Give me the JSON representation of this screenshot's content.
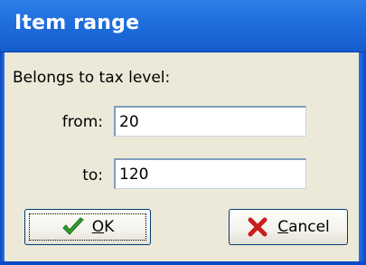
{
  "window": {
    "title": "Item range"
  },
  "form": {
    "heading": "Belongs to tax level:",
    "from_label": "from:",
    "from_value": "20",
    "to_label": "to:",
    "to_value": "120"
  },
  "buttons": {
    "ok": {
      "accel": "O",
      "rest": "K",
      "icon": "checkmark-icon"
    },
    "cancel": {
      "accel": "C",
      "rest": "ancel",
      "icon": "x-icon"
    }
  },
  "colors": {
    "titlebar": "#1f6ddd",
    "dialog_bg": "#ece9d8",
    "check_green": "#2f9e2f",
    "x_red": "#c81e1e"
  }
}
